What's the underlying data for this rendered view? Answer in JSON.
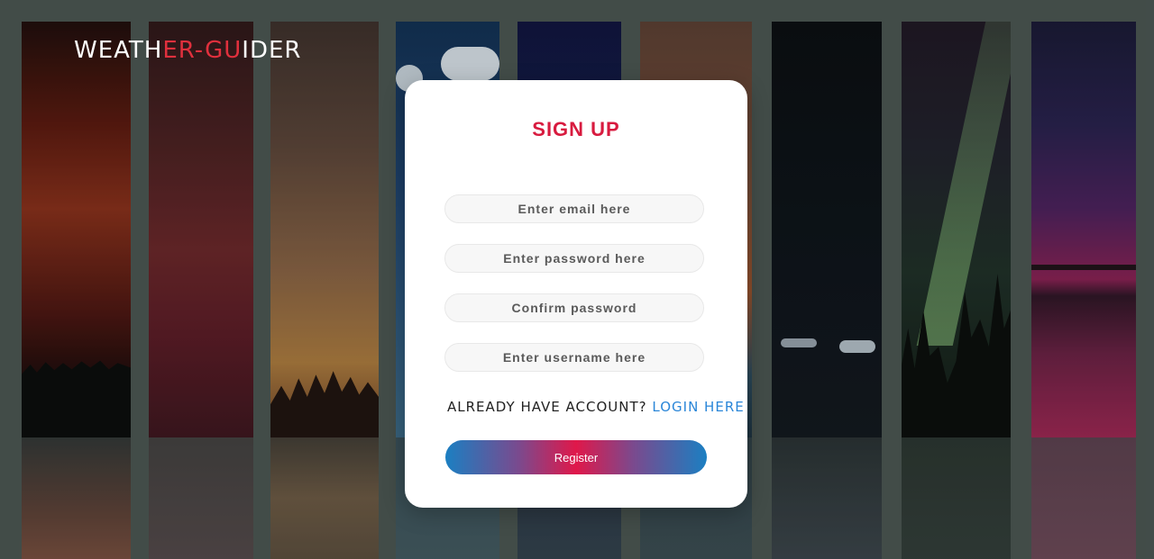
{
  "logo": {
    "part1": "WEATH",
    "part2": "ER-GU",
    "part3": "IDER",
    "accent_color": "#e0303d"
  },
  "form": {
    "title": "SIGN UP",
    "email_placeholder": "Enter email here",
    "password_placeholder": "Enter password here",
    "confirm_placeholder": "Confirm password",
    "username_placeholder": "Enter username here",
    "account_prompt": "ALREADY HAVE ACCOUNT?",
    "login_link": "LOGIN HERE",
    "register_label": "Register"
  },
  "colors": {
    "title": "#d81b3f",
    "link": "#2a86d8",
    "button_gradient": [
      "#1b7fc2",
      "#e0184a",
      "#1b7fc2"
    ]
  }
}
